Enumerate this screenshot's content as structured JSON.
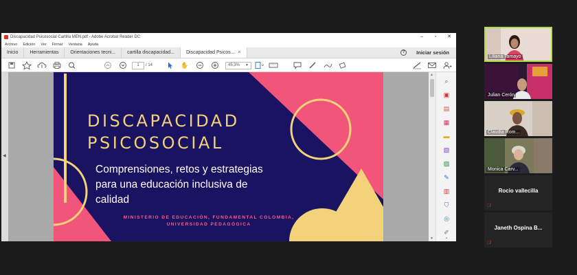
{
  "window": {
    "title": "Discapacidad Psicosocial Cartilla MEN.pdf - Adobe Acrobat Reader DC",
    "minimize": "–",
    "maximize": "▫",
    "close": "✕"
  },
  "menu": [
    "Archivo",
    "Edición",
    "Ver",
    "Firmar",
    "Ventana",
    "Ayuda"
  ],
  "tabs": {
    "home": "Inicio",
    "tools": "Herramientas",
    "doc1": "Orientaciones tecni...",
    "doc2": "cartilla discapacidad...",
    "doc3": "Discapacidad Psicos...",
    "close_glyph": "×",
    "help_glyph": "?",
    "signin": "Iniciar sesión"
  },
  "toolbar": {
    "page_current": "1",
    "page_total": "/ 14",
    "zoom": "45,3%"
  },
  "slide": {
    "title_line1": "DISCAPACIDAD",
    "title_line2": "PSICOSOCIAL",
    "subtitle_line1": "Comprensiones, retos y estrategias",
    "subtitle_line2": "para una educación inclusiva de",
    "subtitle_line3": "calidad",
    "credits_line1": "MINISTERIO DE EDUCACIÓN, FUNDAMENTAL COLOMBIA,",
    "credits_line2": "UNIVERSIDAD PEDAGÓGICA"
  },
  "participants": [
    {
      "name": "Liliana Tamayo",
      "video": true,
      "active": true
    },
    {
      "name": "Julian Cerón",
      "video": true,
      "active": false
    },
    {
      "name": "Claudia Rom...",
      "video": true,
      "active": false
    },
    {
      "name": "Monica Carv...",
      "video": true,
      "active": false
    },
    {
      "name": "Rocio vallecilla",
      "video": false,
      "muted": true
    },
    {
      "name": "Janeth Ospina B...",
      "video": false,
      "muted": true
    }
  ],
  "colors": {
    "slide_navy": "#1a1361",
    "slide_pink": "#f2557a",
    "slide_yellow": "#f3d27a",
    "active_speaker": "#b5d94a"
  }
}
